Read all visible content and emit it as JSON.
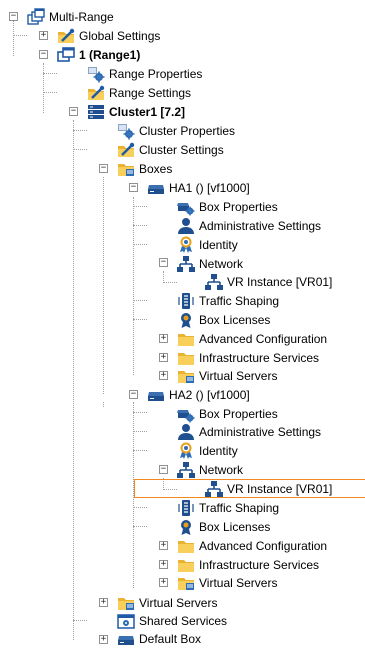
{
  "tree": {
    "root": "Multi-Range",
    "global_settings": "Global Settings",
    "range": "1 (Range1)",
    "range_properties": "Range Properties",
    "range_settings": "Range Settings",
    "cluster": "Cluster1 [7.2]",
    "cluster_properties": "Cluster Properties",
    "cluster_settings": "Cluster Settings",
    "boxes": "Boxes",
    "ha1": {
      "name": "HA1 () [vf1000]",
      "box_properties": "Box Properties",
      "administrative_settings": "Administrative Settings",
      "identity": "Identity",
      "network": "Network",
      "vr_instance": "VR Instance [VR01]",
      "traffic_shaping": "Traffic Shaping",
      "box_licenses": "Box Licenses",
      "advanced_configuration": "Advanced Configuration",
      "infrastructure_services": "Infrastructure Services",
      "virtual_servers": "Virtual Servers"
    },
    "ha2": {
      "name": "HA2 () [vf1000]",
      "box_properties": "Box Properties",
      "administrative_settings": "Administrative Settings",
      "identity": "Identity",
      "network": "Network",
      "vr_instance": "VR Instance [VR01]",
      "traffic_shaping": "Traffic Shaping",
      "box_licenses": "Box Licenses",
      "advanced_configuration": "Advanced Configuration",
      "infrastructure_services": "Infrastructure Services",
      "virtual_servers": "Virtual Servers"
    },
    "cluster_virtual_servers": "Virtual Servers",
    "shared_services": "Shared Services",
    "default_box": "Default Box"
  },
  "expander_symbols": {
    "collapsed": "+",
    "expanded": "−"
  },
  "colors": {
    "selection_border": "#f28a1e",
    "tree_line": "#a0a0a0",
    "folder": "#f5c342",
    "icon_blue": "#1f5aa6"
  }
}
